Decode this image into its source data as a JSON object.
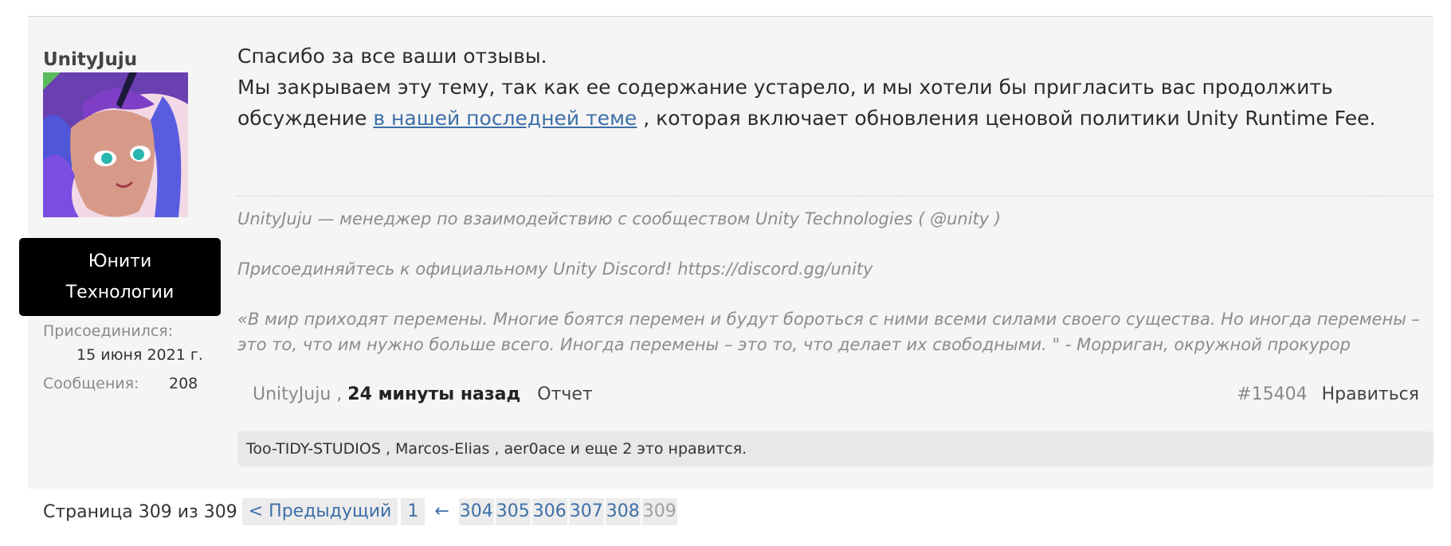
{
  "author": {
    "username": "UnityJuju",
    "role_line1": "Юнити",
    "role_line2": "Технологии",
    "joined_label": "Присоединился:",
    "joined_value": "15 июня 2021 г.",
    "messages_label": "Сообщения:",
    "messages_value": "208"
  },
  "post": {
    "line1": "Спасибо за все ваши отзывы.",
    "line2_before_link": "Мы закрываем эту тему, так как ее содержание устарело, и мы хотели бы пригласить вас продолжить обсуждение ",
    "link_text": "в нашей последней теме",
    "line2_after_link": " , которая включает обновления ценовой политики Unity Runtime Fee."
  },
  "signature": {
    "line1": "UnityJuju — менеджер по взаимодействию с сообществом Unity Technologies ( @unity )",
    "line2": "Присоединяйтесь к официальному Unity Discord! https://discord.gg/unity",
    "line3": "«В мир приходят перемены. Многие боятся перемен и будут бороться с ними всеми силами своего существа. Но иногда перемены – это то, что им нужно больше всего. Иногда перемены – это то, что делает их свободными. \" - Морриган, окружной прокурор"
  },
  "meta": {
    "author": "UnityJuju",
    "sep": " ,",
    "time": "24 минуты назад",
    "report": "Отчет",
    "post_number": "#15404",
    "like": "Нравиться"
  },
  "likes": {
    "text": "Too-TIDY-STUDIOS , Marcos-Elias , aer0ace и еще 2 это нравится."
  },
  "pagination": {
    "label": "Страница 309 из 309",
    "prev": "< Предыдущий",
    "first": "1",
    "arrow": "←",
    "pages": [
      "304",
      "305",
      "306",
      "307",
      "308"
    ],
    "current": "309"
  },
  "colors": {
    "link": "#3d6fa8",
    "badge_bg": "#000000",
    "post_bg": "#f5f5f5"
  }
}
